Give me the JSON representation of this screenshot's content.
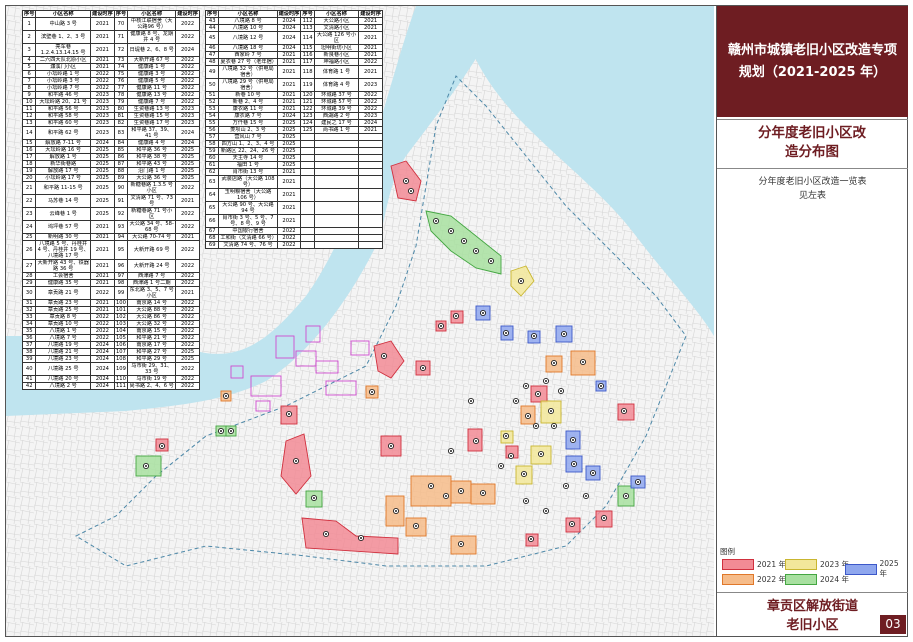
{
  "panel": {
    "title": "赣州市城镇老旧小区改造专项规划（2021-2025 年）",
    "subtitle": "分年度老旧小区改造分布图",
    "note_line1": "分年度老旧小区改造一览表",
    "note_line2": "见左表",
    "legend_title": "图例",
    "legend": [
      {
        "label": "2021 年",
        "fill": "#f28b95",
        "stroke": "#d0303e"
      },
      {
        "label": "2023 年",
        "fill": "#f2e79a",
        "stroke": "#c9b630"
      },
      {
        "label": "2025 年",
        "fill": "#8fa7ee",
        "stroke": "#3c58c9"
      },
      {
        "label": "2022 年",
        "fill": "#f6bc8a",
        "stroke": "#e0782a"
      },
      {
        "label": "2024 年",
        "fill": "#a8e0a0",
        "stroke": "#44a642"
      }
    ],
    "bottom_line1": "章贡区解放街道",
    "bottom_line2": "老旧小区",
    "page_number": "03"
  },
  "table_headers": [
    "序号",
    "小区名称",
    "建设时序",
    "序号",
    "小区名称",
    "建设时序"
  ],
  "table_left": [
    [
      "1",
      "中山路 3 号",
      "2021",
      "70",
      "中核江联宿舍（大公路96 号）",
      "2022"
    ],
    [
      "2",
      "滨壁巷 1、2、3 号",
      "2021",
      "71",
      "健康路 8 号、龙期井 4 号",
      "2022"
    ],
    [
      "3",
      "亮车巷 1.2.4.13.14.15 号",
      "2021",
      "72",
      "日堤巷 2、6、8 号",
      "2024"
    ],
    [
      "4",
      "二六四大队北原小区",
      "2021",
      "73",
      "大新开路 67 号",
      "2022"
    ],
    [
      "5",
      "濂溪门小区",
      "2021",
      "74",
      "健康路 1 号",
      "2022"
    ],
    [
      "6",
      "小坛岭路 1 号",
      "2022",
      "75",
      "健康路 3 号",
      "2022"
    ],
    [
      "7",
      "小坛岭路 3 号",
      "2022",
      "76",
      "健康路 5 号",
      "2022"
    ],
    [
      "8",
      "小坛岭路 7 号",
      "2022",
      "77",
      "健康路 11 号",
      "2022"
    ],
    [
      "9",
      "和平路 46 号",
      "2023",
      "78",
      "健康路 13 号",
      "2022"
    ],
    [
      "10",
      "大坛岭路 20、21 号",
      "2023",
      "79",
      "健康路 7 号",
      "2022"
    ],
    [
      "11",
      "和平路 56 号",
      "2023",
      "80",
      "生资巷路 13 号",
      "2023"
    ],
    [
      "12",
      "和平路 58 号",
      "2023",
      "81",
      "生资巷路 15 号",
      "2023"
    ],
    [
      "13",
      "和平路 60 号",
      "2023",
      "82",
      "生资巷路 17 号",
      "2023"
    ],
    [
      "14",
      "和平路 62 号",
      "2023",
      "83",
      "和平路 37、39、41 号",
      "2024"
    ],
    [
      "15",
      "解放路 7-11 号",
      "2024",
      "84",
      "健康路 4 号",
      "2024"
    ],
    [
      "16",
      "大坛岭路 16 号",
      "2025",
      "85",
      "和平路 36 号",
      "2025"
    ],
    [
      "17",
      "解放路 1 号",
      "2025",
      "86",
      "和平路 38 号",
      "2025"
    ],
    [
      "18",
      "新华街巷路",
      "2025",
      "87",
      "和平路 43 号",
      "2025"
    ],
    [
      "19",
      "解放路 17 号",
      "2025",
      "88",
      "沿门路 1 号",
      "2025"
    ],
    [
      "20",
      "小坛岭路 17 号",
      "2025",
      "89",
      "大公路 36 号",
      "2025"
    ],
    [
      "21",
      "和平路 11-15 号",
      "2025",
      "90",
      "新糖巷路 1.3.5 号小区",
      "2022"
    ],
    [
      "22",
      "马苏巷 14 号",
      "2025",
      "91",
      "文清路 71 号、73 号",
      "2021"
    ],
    [
      "23",
      "云峰巷 1 号",
      "2025",
      "92",
      "新糖巷路 71 号小区",
      "2022"
    ],
    [
      "24",
      "坞坪巷 57 号",
      "2021",
      "93",
      "大公路 34 号、58-68 号",
      "2022"
    ],
    [
      "25",
      "新明路 30 号",
      "2021",
      "94",
      "大公路 70-74 号",
      "2021"
    ],
    [
      "26",
      "八境路 5 号、丹桂井 4 号、丹桂井 19 号、八境路 17 号",
      "2021",
      "95",
      "大新开路 69 号",
      "2022"
    ],
    [
      "27",
      "大新开路 43 号、铁器路 36 号",
      "2021",
      "96",
      "大新开路 24 号",
      "2022"
    ],
    [
      "28",
      "工会宿舍",
      "2021",
      "97",
      "西津路 7 号",
      "2022"
    ],
    [
      "29",
      "健康路 35 号",
      "2021",
      "98",
      "西津路 1 号二期",
      "2022"
    ],
    [
      "30",
      "章贡路 21 号",
      "2022",
      "99",
      "东北路 3、5、7 号小区",
      "2021"
    ],
    [
      "31",
      "章贡路 23 号",
      "2021",
      "100",
      "南京路 14 号",
      "2022"
    ],
    [
      "32",
      "章贡路 25 号",
      "2021",
      "101",
      "大公路 88 号",
      "2022"
    ],
    [
      "33",
      "章贡路 8 号",
      "2022",
      "102",
      "大公路 86 号",
      "2022"
    ],
    [
      "34",
      "章贡路 10 号",
      "2022",
      "103",
      "大公路 32 号",
      "2022"
    ],
    [
      "35",
      "八境路 1 号",
      "2022",
      "104",
      "南京路 15 号",
      "2022"
    ],
    [
      "36",
      "八境路 7 号",
      "2022",
      "105",
      "和平路 21 号",
      "2022"
    ],
    [
      "37",
      "八境路 19 号",
      "2024",
      "106",
      "南京路 17 号",
      "2022"
    ],
    [
      "38",
      "八境路 21 号",
      "2024",
      "107",
      "和平路 27 号",
      "2025"
    ],
    [
      "39",
      "八境路 23 号",
      "2024",
      "108",
      "和平路 29 号",
      "2025"
    ],
    [
      "40",
      "八境路 25 号",
      "2024",
      "109",
      "马市街 29、31、33 号",
      "2022"
    ],
    [
      "41",
      "八境路 20 号",
      "2024",
      "110",
      "马市街 19 号",
      "2022"
    ],
    [
      "42",
      "八境路 2 号",
      "2024",
      "111",
      "尚书路 2、4、6 号",
      "2022"
    ]
  ],
  "table_right": [
    [
      "43",
      "八境路 8 号",
      "2024",
      "112",
      "大公路小区",
      "2021"
    ],
    [
      "44",
      "八境路 10 号",
      "2024",
      "113",
      "文清路小区",
      "2021"
    ],
    [
      "45",
      "八境路 12 号",
      "2024",
      "114",
      "大公路 126 号小区",
      "2021"
    ],
    [
      "46",
      "八境路 18 号",
      "2024",
      "115",
      "坦明街坊小区",
      "2021"
    ],
    [
      "47",
      "西家岭 7 号",
      "2021",
      "116",
      "新良巷小区",
      "2021"
    ],
    [
      "48",
      "夏衣巷 27 号（老年宿）",
      "2021",
      "117",
      "坤福路小区",
      "2022"
    ],
    [
      "49",
      "八境路 32 号（供电局宿舍）",
      "2021",
      "118",
      "体育路 1 号",
      "2021"
    ],
    [
      "50",
      "八境路 29 号（供电局宿舍）",
      "2021",
      "119",
      "体育路 4 号",
      "2023"
    ],
    [
      "51",
      "新巷 10 号",
      "2021",
      "120",
      "环城路 37 号",
      "2022"
    ],
    [
      "52",
      "新巷 2、4 号",
      "2021",
      "121",
      "环城路 57 号",
      "2022"
    ],
    [
      "53",
      "康衣路 11 号",
      "2021",
      "122",
      "环城路 39 号",
      "2022"
    ],
    [
      "54",
      "康衣路 7 号",
      "2024",
      "123",
      "西湖路 2 号",
      "2023"
    ],
    [
      "55",
      "万仟巷 15 号",
      "2025",
      "124",
      "建民之 17 号",
      "2024"
    ],
    [
      "56",
      "菱坝山 2、3 号",
      "2025",
      "125",
      "尚书路 1 号",
      "2021"
    ],
    [
      "57",
      "营风山 7 号",
      "2025",
      "",
      "",
      "",
      ""
    ],
    [
      "58",
      "四方山 1、2、3、4 号",
      "2025",
      "",
      "",
      "",
      ""
    ],
    [
      "59",
      "新路区 22、24、26 号",
      "2025",
      "",
      "",
      "",
      ""
    ],
    [
      "60",
      "天主寺 14 号",
      "2025",
      "",
      "",
      "",
      ""
    ],
    [
      "61",
      "福田 1 号",
      "2025",
      "",
      "",
      "",
      ""
    ],
    [
      "62",
      "肖市街 13 号",
      "2021",
      "",
      "",
      "",
      ""
    ],
    [
      "63",
      "武装店路（大公路 108 号）",
      "2021",
      "",
      "",
      "",
      ""
    ],
    [
      "64",
      "玉明粮宿舍（大公路 106 号）",
      "2021",
      "",
      "",
      "",
      ""
    ],
    [
      "65",
      "大公路 90 号、大公路 94 号",
      "2021",
      "",
      "",
      "",
      ""
    ],
    [
      "66",
      "肖市街 3 号、5 号、7 号、8 号、9 号",
      "2021",
      "",
      "",
      "",
      ""
    ],
    [
      "67",
      "中国银行宿舍",
      "2022",
      "",
      "",
      "",
      ""
    ],
    [
      "68",
      "工和街（文清路 66 号）",
      "2022",
      "",
      "",
      "",
      ""
    ],
    [
      "69",
      "文清路 74 号、76 号",
      "2022",
      "",
      "",
      "",
      ""
    ]
  ]
}
